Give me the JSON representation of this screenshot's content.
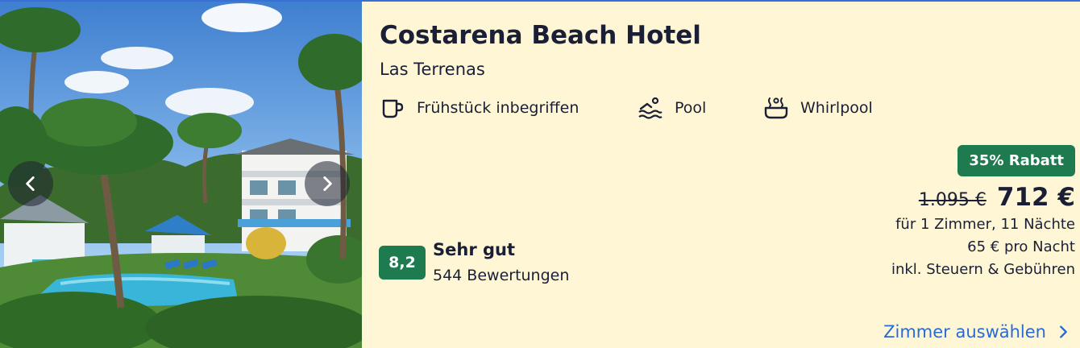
{
  "hotel": {
    "name": "Costarena Beach Hotel",
    "location": "Las Terrenas"
  },
  "amenities": [
    {
      "label": "Frühstück inbegriffen",
      "icon": "coffee-cup-icon"
    },
    {
      "label": "Pool",
      "icon": "pool-icon"
    },
    {
      "label": "Whirlpool",
      "icon": "hot-tub-icon"
    }
  ],
  "rating": {
    "score": "8,2",
    "label": "Sehr gut",
    "reviews": "544 Bewertungen"
  },
  "price": {
    "discount": "35% Rabatt",
    "old": "1.095 €",
    "new": "712 €",
    "details": [
      "für 1 Zimmer, 11 Nächte",
      "65 € pro Nacht",
      "inkl. Steuern & Gebühren"
    ]
  },
  "cta": {
    "label": "Zimmer auswählen"
  },
  "gallery": {
    "prev_icon": "chevron-left-icon",
    "next_icon": "chevron-right-icon"
  },
  "colors": {
    "background": "#fff6d6",
    "accent_green": "#1e7b4f",
    "link_blue": "#2a6ad6",
    "text": "#1a1f36"
  }
}
